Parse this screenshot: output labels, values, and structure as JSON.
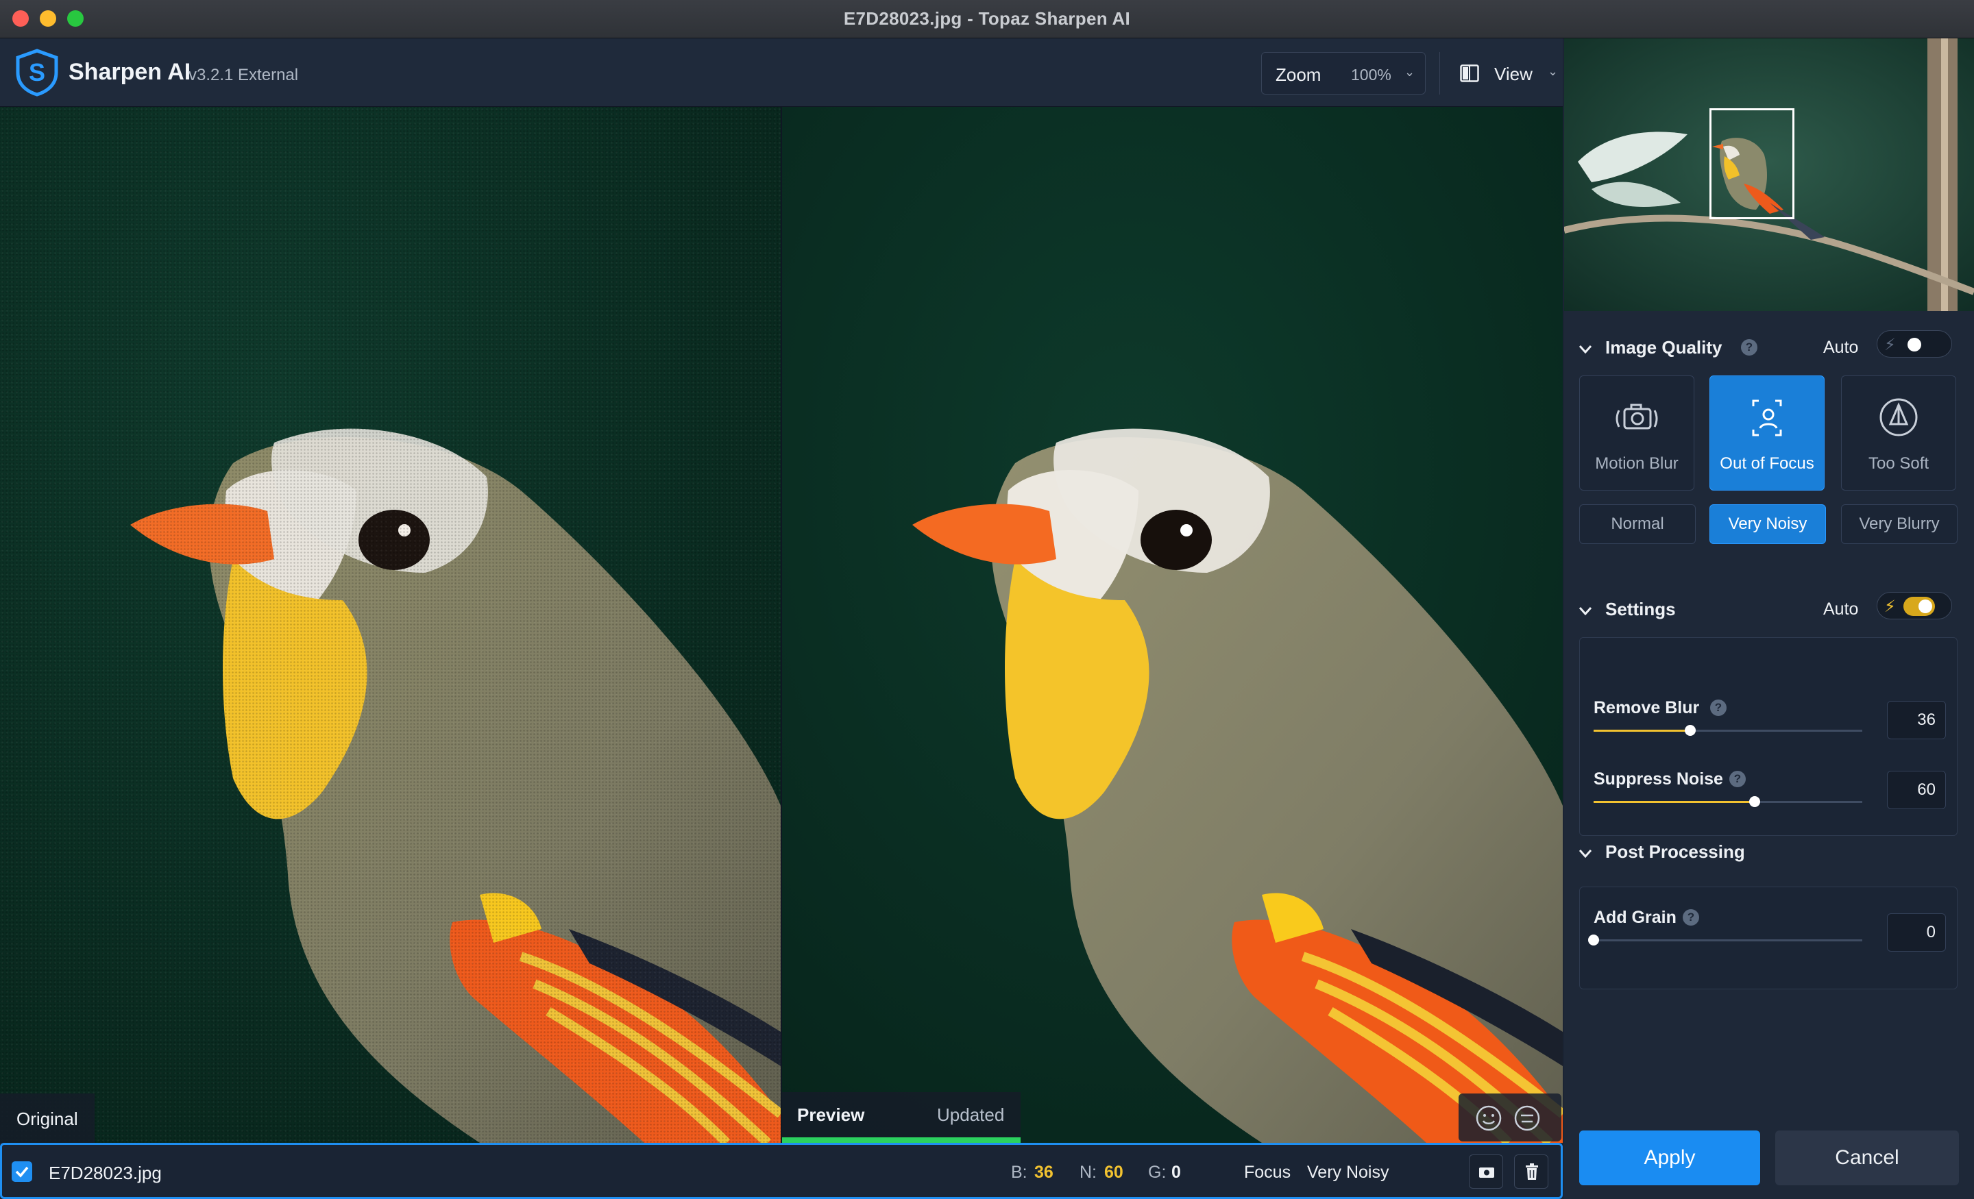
{
  "window": {
    "title": "E7D28023.jpg - Topaz Sharpen AI"
  },
  "header": {
    "app_name": "Sharpen AI",
    "version": "v3.2.1 External",
    "zoom_label": "Zoom",
    "zoom_value": "100%",
    "view_label": "View"
  },
  "viewer": {
    "original_label": "Original",
    "preview_label": "Preview",
    "updated_label": "Updated",
    "preview_progress": 1.0
  },
  "filebar": {
    "checked": true,
    "filename": "E7D28023.jpg",
    "blur_label": "B:",
    "blur_value": "36",
    "noise_label": "N:",
    "noise_value": "60",
    "grain_label": "G:",
    "grain_value": "0",
    "mode_label": "Focus",
    "mode_value": "Very Noisy"
  },
  "panel": {
    "image_quality": {
      "title": "Image Quality",
      "auto_label": "Auto",
      "auto_on": false,
      "types": [
        {
          "label": "Motion Blur",
          "icon": "camera-shake-icon",
          "active": false
        },
        {
          "label": "Out of Focus",
          "icon": "focus-person-icon",
          "active": true
        },
        {
          "label": "Too Soft",
          "icon": "sharpness-icon",
          "active": false
        }
      ],
      "modes": [
        {
          "label": "Normal",
          "active": false
        },
        {
          "label": "Very Noisy",
          "active": true
        },
        {
          "label": "Very Blurry",
          "active": false
        }
      ]
    },
    "settings": {
      "title": "Settings",
      "auto_label": "Auto",
      "auto_on": true,
      "remove_blur": {
        "label": "Remove Blur",
        "value": "36",
        "fraction": 0.36
      },
      "suppress_noise": {
        "label": "Suppress Noise",
        "value": "60",
        "fraction": 0.6
      }
    },
    "post_processing": {
      "title": "Post Processing",
      "add_grain": {
        "label": "Add Grain",
        "value": "0",
        "fraction": 0.0
      }
    },
    "apply_label": "Apply",
    "cancel_label": "Cancel"
  },
  "colors": {
    "accent": "#1a8cf2",
    "slider_fill": "#f2c230",
    "progress": "#2bd15f",
    "panel_bg": "#1e2838"
  }
}
